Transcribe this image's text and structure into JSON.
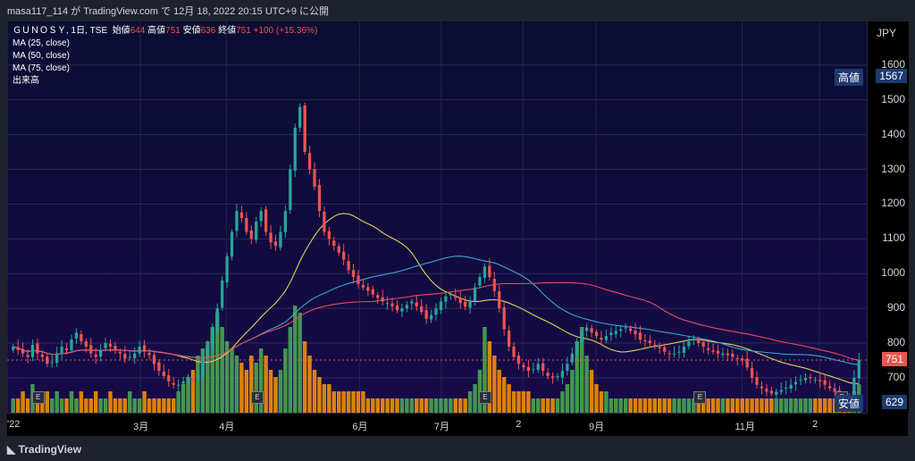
{
  "header": {
    "text": "masa117_114 が TradingView.com で 12月 18, 2022 20:15 UTC+9 に公開"
  },
  "legend": {
    "symbol": "ＧＵＮＯＳＹ, 1日, TSE",
    "open_label": "始値",
    "open": "644",
    "high_label": "高値",
    "high": "751",
    "low_label": "安値",
    "low": "636",
    "close_label": "終値",
    "close": "751",
    "change": "+100 (+15.36%)",
    "ma25": "MA (25, close)",
    "ma50": "MA (50, close)",
    "ma75": "MA (75, close)",
    "volume": "出来高"
  },
  "footer": {
    "logo": "TradingView"
  },
  "colors": {
    "up": "#26a69a",
    "down": "#ef5350",
    "ma25": "#e5d152",
    "ma50": "#38a8d8",
    "ma75": "#e84a5f",
    "vol_up": "#4caf50",
    "vol_down": "#ff9800"
  },
  "chart_data": {
    "type": "candlestick",
    "currency": "JPY",
    "y_ticks": [
      700,
      800,
      900,
      1000,
      1100,
      1200,
      1300,
      1400,
      1500,
      1600
    ],
    "ylim": [
      620,
      1700
    ],
    "x_ticks": [
      "'22",
      "3月",
      "4月",
      "6月",
      "7月",
      "2",
      "9月",
      "11月",
      "2"
    ],
    "price_tags": [
      {
        "label": "高値",
        "value": "1567",
        "color": "#1e3a6e"
      },
      {
        "label": "",
        "value": "751",
        "color": "#ef5350"
      },
      {
        "label": "安値",
        "value": "629",
        "color": "#1e3a6e"
      }
    ],
    "earnings_markers": [
      "E",
      "E",
      "E",
      "E",
      "E"
    ],
    "close_series": [
      790,
      780,
      770,
      760,
      795,
      770,
      760,
      740,
      745,
      770,
      790,
      780,
      810,
      830,
      805,
      790,
      770,
      760,
      780,
      800,
      790,
      780,
      770,
      755,
      760,
      770,
      790,
      775,
      765,
      740,
      720,
      705,
      690,
      680,
      680,
      690,
      700,
      690,
      710,
      760,
      790,
      840,
      900,
      980,
      1050,
      1120,
      1180,
      1160,
      1120,
      1100,
      1150,
      1180,
      1120,
      1090,
      1080,
      1120,
      1180,
      1300,
      1420,
      1480,
      1350,
      1300,
      1250,
      1180,
      1120,
      1100,
      1080,
      1060,
      1040,
      1010,
      990,
      970,
      960,
      950,
      940,
      930,
      920,
      915,
      905,
      895,
      900,
      910,
      920,
      905,
      890,
      870,
      880,
      900,
      920,
      935,
      940,
      930,
      915,
      905,
      920,
      960,
      990,
      1020,
      990,
      950,
      900,
      840,
      790,
      760,
      740,
      730,
      720,
      725,
      740,
      720,
      705,
      700,
      705,
      720,
      740,
      770,
      800,
      830,
      845,
      830,
      820,
      810,
      820,
      830,
      835,
      840,
      845,
      835,
      825,
      810,
      805,
      800,
      790,
      785,
      775,
      770,
      770,
      775,
      790,
      805,
      810,
      800,
      790,
      780,
      775,
      770,
      770,
      765,
      760,
      755,
      750,
      730,
      700,
      680,
      670,
      660,
      655,
      660,
      665,
      672,
      680,
      688,
      695,
      700,
      700,
      695,
      690,
      680,
      670,
      660,
      650,
      645,
      640,
      700,
      751
    ],
    "volume_series": [
      2,
      2,
      3,
      2,
      4,
      2,
      2,
      3,
      2,
      3,
      2,
      2,
      3,
      2,
      3,
      2,
      2,
      3,
      2,
      2,
      3,
      2,
      2,
      2,
      3,
      2,
      2,
      3,
      2,
      2,
      2,
      2,
      2,
      2,
      3,
      4,
      5,
      6,
      8,
      9,
      10,
      12,
      14,
      12,
      10,
      9,
      8,
      7,
      6,
      8,
      7,
      9,
      8,
      6,
      5,
      6,
      9,
      12,
      15,
      14,
      10,
      8,
      6,
      5,
      4,
      4,
      3,
      3,
      3,
      3,
      3,
      3,
      3,
      2,
      2,
      2,
      2,
      2,
      2,
      2,
      2,
      2,
      2,
      2,
      2,
      2,
      2,
      2,
      2,
      2,
      2,
      2,
      2,
      2,
      3,
      4,
      6,
      12,
      10,
      8,
      6,
      5,
      4,
      3,
      3,
      3,
      3,
      2,
      2,
      2,
      2,
      2,
      2,
      3,
      4,
      6,
      10,
      12,
      8,
      6,
      4,
      3,
      3,
      2,
      2,
      2,
      2,
      2,
      2,
      2,
      2,
      2,
      2,
      2,
      2,
      2,
      2,
      2,
      2,
      2,
      2,
      2,
      2,
      2,
      2,
      2,
      2,
      2,
      2,
      2,
      2,
      2,
      2,
      2,
      2,
      2,
      2,
      2,
      2,
      2,
      2,
      2,
      2,
      2,
      2,
      2,
      2,
      2,
      2,
      2,
      2,
      2,
      2,
      3,
      4
    ]
  }
}
